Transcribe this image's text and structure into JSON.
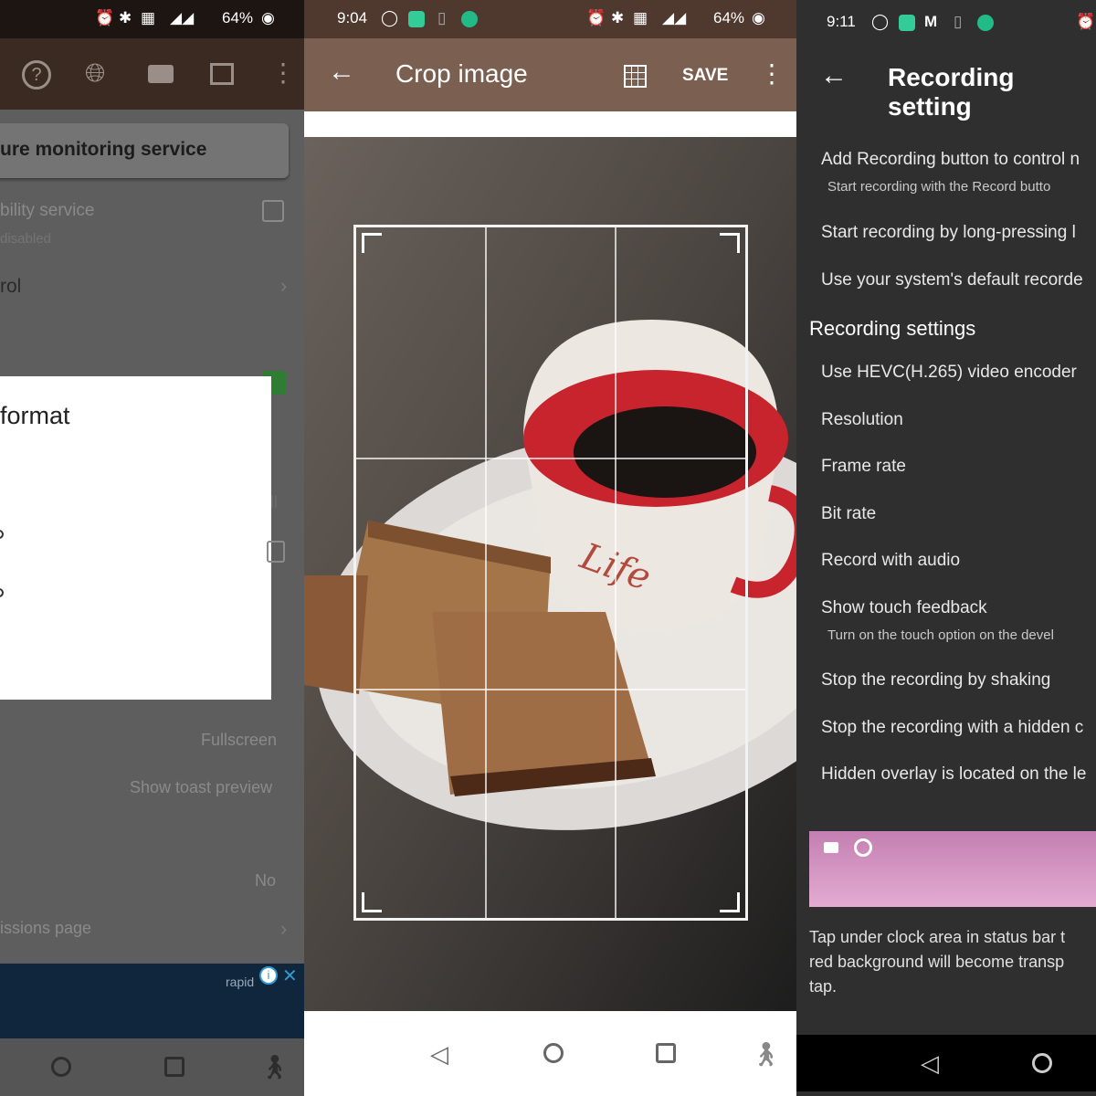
{
  "panel1": {
    "status": {
      "battery": "64%"
    },
    "toolbar_icons": [
      "help-icon",
      "globe-icon",
      "video-icon",
      "image-icon",
      "more-icon"
    ],
    "service_button": "ure monitoring service",
    "accessibility": {
      "title": "bility service",
      "subtitle": "disabled"
    },
    "control_row": "rol",
    "dialog_title": "format",
    "fullscreen_value": "Fullscreen",
    "toast_value": "Show toast preview",
    "no_value": "No",
    "permissions_row": "issions page",
    "ad_label": "rapid"
  },
  "panel2": {
    "status": {
      "time": "9:04",
      "battery": "64%"
    },
    "title": "Crop image",
    "save_label": "SAVE",
    "mug_text": "Life"
  },
  "panel3": {
    "status": {
      "time": "9:11"
    },
    "title": "Recording setting",
    "items": [
      {
        "label": "Add Recording button to control n",
        "sub": "Start recording with the Record butto"
      },
      {
        "label": "Start recording by long-pressing l"
      },
      {
        "label": "Use your system's default recorde"
      }
    ],
    "section_title": "Recording settings",
    "settings": [
      {
        "label": "Use HEVC(H.265) video encoder"
      },
      {
        "label": "Resolution"
      },
      {
        "label": "Frame rate"
      },
      {
        "label": "Bit rate"
      },
      {
        "label": "Record with audio"
      },
      {
        "label": "Show touch feedback",
        "sub": "Turn on the touch option on the devel"
      },
      {
        "label": "Stop the recording by shaking"
      },
      {
        "label": "Stop the recording with a hidden c"
      },
      {
        "label": "Hidden overlay is located on the le"
      }
    ],
    "note_lines": [
      "Tap under clock area in status bar t",
      "red background will become transp",
      "tap."
    ]
  }
}
